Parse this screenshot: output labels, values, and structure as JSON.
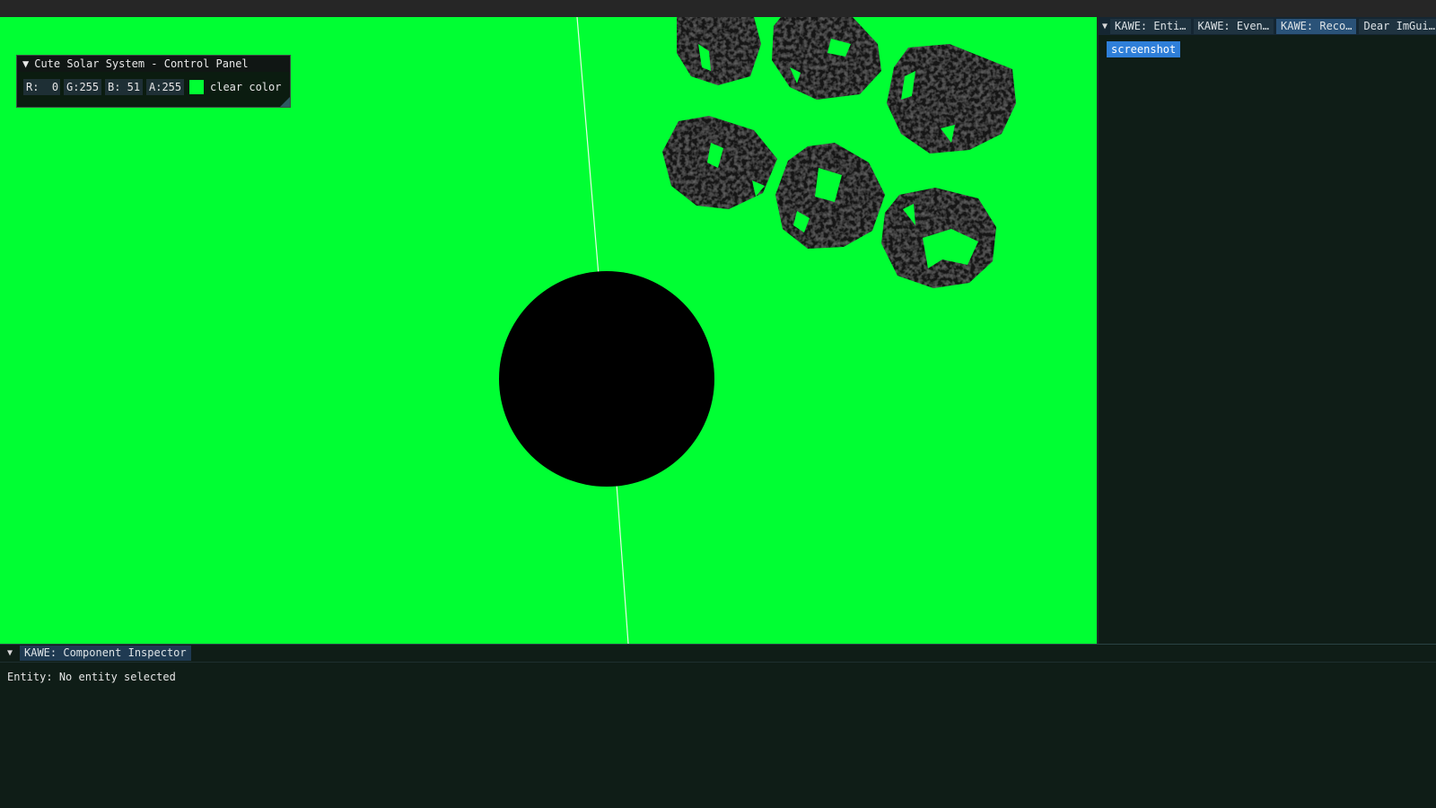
{
  "colors": {
    "clear_color": "#00ff33",
    "planet": "#000000",
    "panel_bg": "#0c0e0e",
    "dock_bg": "#0f1d17",
    "button_blue": "#2f7fd9"
  },
  "control_panel": {
    "collapse_icon": "collapse-triangle-icon",
    "title": "Cute Solar System - Control Panel",
    "channels": {
      "r": "R:  0",
      "g": "G:255",
      "b": "B: 51",
      "a": "A:255"
    },
    "clear_color_label": "clear color"
  },
  "right_dock": {
    "menu_icon": "dock-menu-icon",
    "tabs": [
      {
        "label": "KAWE: Enti…",
        "active": false
      },
      {
        "label": "KAWE: Even…",
        "active": false
      },
      {
        "label": "KAWE: Reco…",
        "active": true
      },
      {
        "label": "Dear ImGui…",
        "active": false
      }
    ],
    "screenshot_button": "screenshot"
  },
  "bottom_dock": {
    "menu_icon": "dock-menu-icon",
    "tab": "KAWE: Component Inspector",
    "entity_label": "Entity:",
    "entity_value": "No entity selected"
  }
}
